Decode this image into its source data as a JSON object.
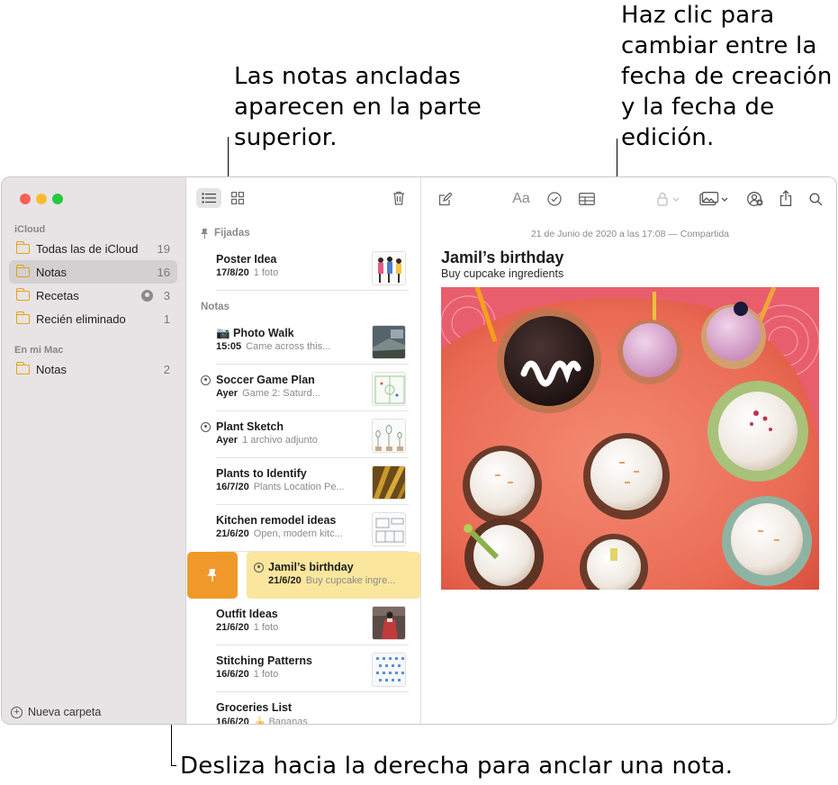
{
  "callouts": {
    "pinned": "Las notas ancladas aparecen en la parte superior.",
    "date": "Haz clic para cambiar entre la fecha de creación y la fecha de edición.",
    "swipe": "Desliza hacia la derecha para anclar una nota."
  },
  "sidebar": {
    "sections": [
      {
        "title": "iCloud",
        "items": [
          {
            "label": "Todas las de iCloud",
            "count": "19"
          },
          {
            "label": "Notas",
            "count": "16",
            "selected": true
          },
          {
            "label": "Recetas",
            "count": "3",
            "shared": true
          },
          {
            "label": "Recién eliminado",
            "count": "1"
          }
        ]
      },
      {
        "title": "En mi Mac",
        "items": [
          {
            "label": "Notas",
            "count": "2"
          }
        ]
      }
    ],
    "new_folder": "Nueva carpeta"
  },
  "list": {
    "pinned_header": "Fijadas",
    "notes_header": "Notas",
    "pinned": [
      {
        "title": "Poster Idea",
        "date": "17/8/20",
        "preview": "1 foto"
      }
    ],
    "notes": [
      {
        "title": "📷 Photo Walk",
        "date": "15:05",
        "preview": "Came across this..."
      },
      {
        "title": "Soccer Game Plan",
        "date": "Ayer",
        "preview": "Game 2: Saturd...",
        "shared": true
      },
      {
        "title": "Plant Sketch",
        "date": "Ayer",
        "preview": "1 archivo adjunto",
        "shared": true
      },
      {
        "title": "Plants to Identify",
        "date": "16/7/20",
        "preview": "Plants Location Pe..."
      },
      {
        "title": "Kitchen remodel ideas",
        "date": "21/6/20",
        "preview": "Open, modern kitc..."
      },
      {
        "title": "Jamil’s birthday",
        "date": "21/6/20",
        "preview": "Buy cupcake ingre...",
        "shared": true,
        "swiped": true
      },
      {
        "title": "Outfit Ideas",
        "date": "21/6/20",
        "preview": "1 foto"
      },
      {
        "title": "Stitching Patterns",
        "date": "16/6/20",
        "preview": "1 foto"
      },
      {
        "title": "Groceries List",
        "date": "16/6/20",
        "preview": "🍌 Bananas"
      }
    ]
  },
  "editor": {
    "date": "21 de Junio de 2020 a las 17:08 — Compartida",
    "title": "Jamil’s birthday",
    "subtitle": "Buy cupcake ingredients",
    "format_label": "Aa"
  },
  "colors": {
    "accent_pin": "#f0992b",
    "swipe_highlight": "#fae69c",
    "folder": "#e3a21a",
    "sidebar_bg": "#e8e4e6"
  }
}
